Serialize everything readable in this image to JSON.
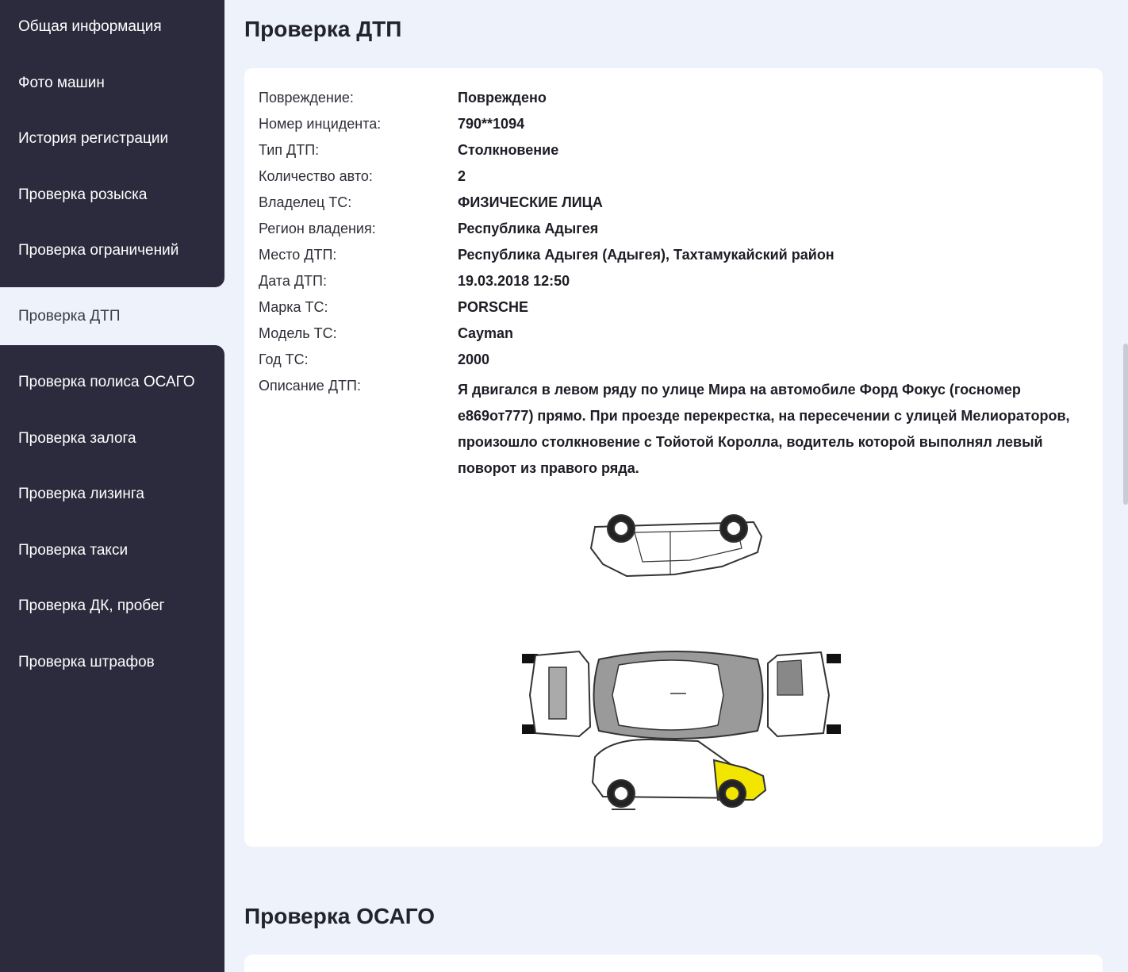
{
  "sidebar": {
    "items": [
      {
        "label": "Общая информация",
        "name": "sidebar-item-general-info"
      },
      {
        "label": "Фото машин",
        "name": "sidebar-item-car-photos"
      },
      {
        "label": "История регистрации",
        "name": "sidebar-item-registration-history"
      },
      {
        "label": "Проверка розыска",
        "name": "sidebar-item-wanted-check"
      },
      {
        "label": "Проверка ограничений",
        "name": "sidebar-item-restrictions-check"
      },
      {
        "label": "Проверка ДТП",
        "name": "sidebar-item-accident-check"
      },
      {
        "label": "Проверка полиса ОСАГО",
        "name": "sidebar-item-osago-policy-check"
      },
      {
        "label": "Проверка залога",
        "name": "sidebar-item-pledge-check"
      },
      {
        "label": "Проверка лизинга",
        "name": "sidebar-item-leasing-check"
      },
      {
        "label": "Проверка такси",
        "name": "sidebar-item-taxi-check"
      },
      {
        "label": "Проверка ДК, пробег",
        "name": "sidebar-item-dk-mileage-check"
      },
      {
        "label": "Проверка штрафов",
        "name": "sidebar-item-fines-check"
      }
    ],
    "active_index": 5
  },
  "accident_section": {
    "title": "Проверка ДТП",
    "rows": [
      {
        "label": "Повреждение:",
        "value": "Повреждено"
      },
      {
        "label": "Номер инцидента:",
        "value": "790**1094"
      },
      {
        "label": "Тип ДТП:",
        "value": "Столкновение"
      },
      {
        "label": "Количество авто:",
        "value": "2"
      },
      {
        "label": "Владелец ТС:",
        "value": "ФИЗИЧЕСКИЕ ЛИЦА"
      },
      {
        "label": "Регион владения:",
        "value": "Республика Адыгея"
      },
      {
        "label": "Место ДТП:",
        "value": "Республика Адыгея (Адыгея), Тахтамукайский район"
      },
      {
        "label": "Дата ДТП:",
        "value": "19.03.2018 12:50"
      },
      {
        "label": "Марка ТС:",
        "value": "PORSCHE"
      },
      {
        "label": "Модель ТС:",
        "value": "Cayman"
      },
      {
        "label": "Год ТС:",
        "value": "2000"
      }
    ],
    "description_label": "Описание ДТП:",
    "description_lines": [
      "Я двигался в левом ряду по улице Мира на автомобиле Форд Фокус (госномер",
      "е869от777) прямо. При проезде перекрестка, на пересечении с улицей Мелиораторов,",
      "произошло столкновение с Тойотой Королла, водитель которой выполнял левый",
      "поворот из правого ряда."
    ],
    "damage_diagram": {
      "icon": "car-damage-diagram",
      "damaged_zone": "right-front-fender",
      "highlight_color": "#f2e600"
    }
  },
  "osago_section": {
    "title": "Проверка ОСАГО"
  },
  "colors": {
    "sidebar_bg": "#2b2b3d",
    "page_bg": "#eef2fa",
    "card_bg": "#ffffff"
  }
}
